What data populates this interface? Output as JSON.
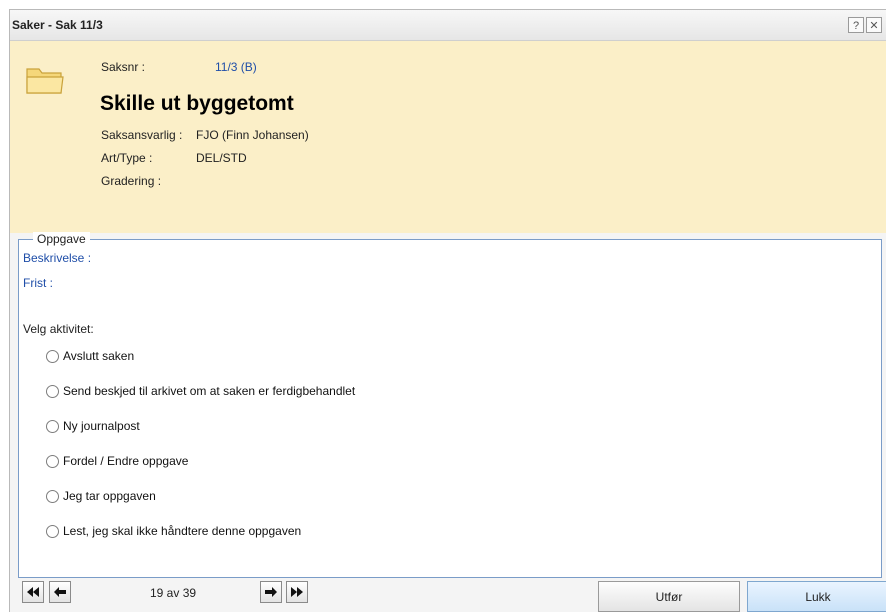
{
  "window": {
    "title": "Saker - Sak 11/3",
    "help_label": "?",
    "close_label": "✕"
  },
  "case": {
    "saksnr_label": "Saksnr :",
    "saksnr_value": "11/3 (B)",
    "title": "Skille ut byggetomt",
    "saksansvarlig_label": "Saksansvarlig :",
    "saksansvarlig_value": "FJO (Finn Johansen)",
    "art_type_label": "Art/Type :",
    "art_type_value": "DEL/STD",
    "gradering_label": "Gradering :",
    "gradering_value": ""
  },
  "task": {
    "legend": "Oppgave",
    "beskrivelse_label": "Beskrivelse :",
    "frist_label": "Frist :",
    "velg_label": "Velg aktivitet:",
    "options": [
      "Avslutt saken",
      "Send beskjed til arkivet om at saken er ferdigbehandlet",
      "Ny journalpost",
      "Fordel / Endre oppgave",
      "Jeg tar oppgaven",
      "Lest, jeg skal ikke håndtere denne oppgaven"
    ]
  },
  "footer": {
    "pager_text": "19 av 39",
    "utfor_label": "Utfør",
    "lukk_label": "Lukk"
  },
  "colors": {
    "header_bg": "#fbefc8",
    "accent_blue": "#1f4ea8",
    "panel_border": "#7a9cc8"
  }
}
